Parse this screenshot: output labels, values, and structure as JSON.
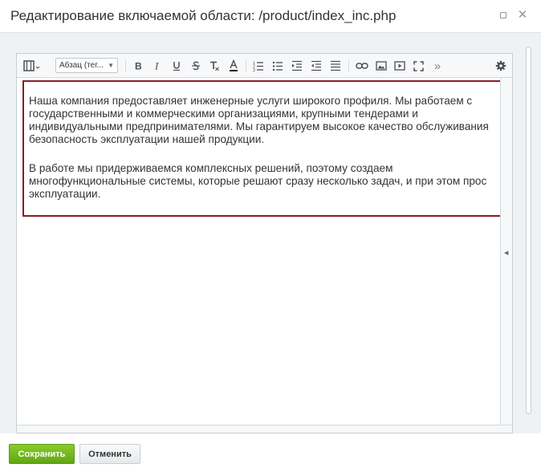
{
  "dialog": {
    "title": "Редактирование включаемой области: /product/index_inc.php"
  },
  "toolbar": {
    "style_select": "Абзац (тег...",
    "more": "»"
  },
  "editor": {
    "paragraph1": [
      "Наша компания предоставляет инженерные услуги широкого профиля. Мы работаем с",
      "государственными и коммерческими организациями, крупными тендерами и",
      "индивидуальными предпринимателями. Мы гарантируем высокое качество обслуживания",
      "безопасность эксплуатации нашей продукции."
    ],
    "paragraph2": [
      "В работе мы придерживаемся комплексных решений, поэтому создаем",
      "многофункциональные системы, которые решают сразу несколько задач, и при этом прос",
      "эксплуатации."
    ]
  },
  "footer": {
    "save_label": "Сохранить",
    "cancel_label": "Отменить"
  },
  "colors": {
    "include_border": "#8b1b24",
    "save_button": "#6cb31c"
  }
}
